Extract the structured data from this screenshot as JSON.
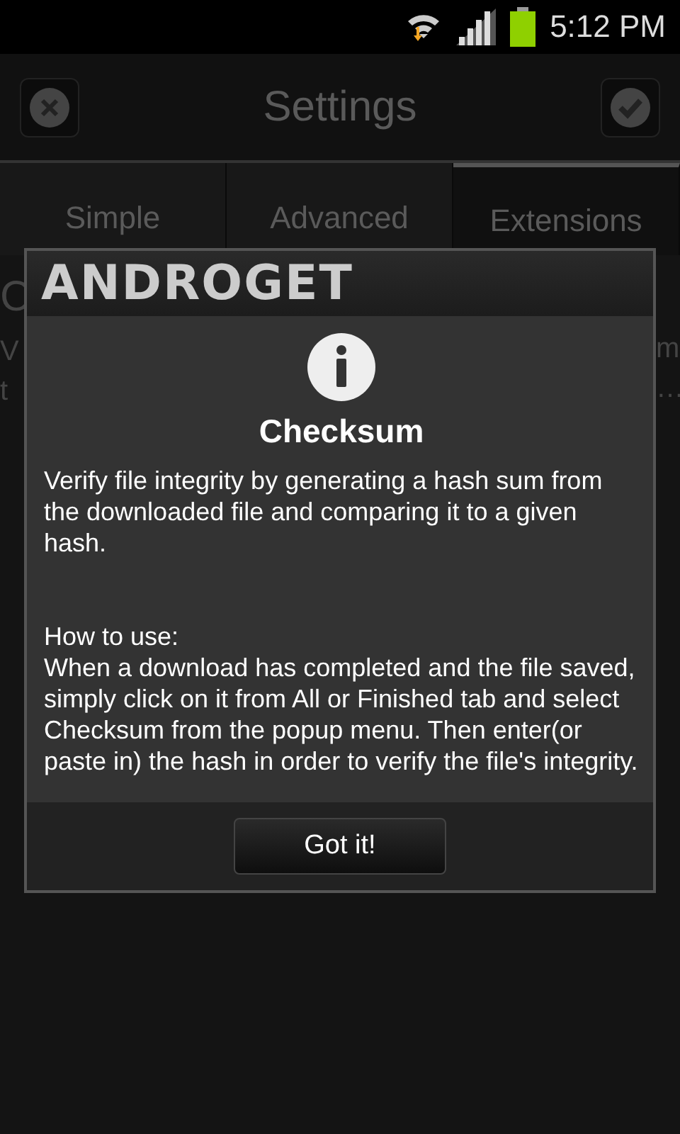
{
  "status_bar": {
    "time": "5:12 PM"
  },
  "title_bar": {
    "title": "Settings"
  },
  "tabs": [
    {
      "label": "Simple",
      "selected": false
    },
    {
      "label": "Advanced",
      "selected": false
    },
    {
      "label": "Extensions",
      "selected": true
    }
  ],
  "background": {
    "left": [
      "C",
      "V",
      "t"
    ],
    "right": [
      "m",
      "…"
    ]
  },
  "dialog": {
    "logo": "ANDROGET",
    "title": "Checksum",
    "paragraphs": [
      "Verify file integrity by generating a hash sum from the downloaded file and comparing it to a given hash.",
      "How to use:\nWhen a download has completed and the file saved, simply click on it from All or Finished tab and select Checksum from the popup menu. Then enter(or paste in) the hash in order to verify the file's integrity."
    ],
    "button": "Got it!"
  }
}
